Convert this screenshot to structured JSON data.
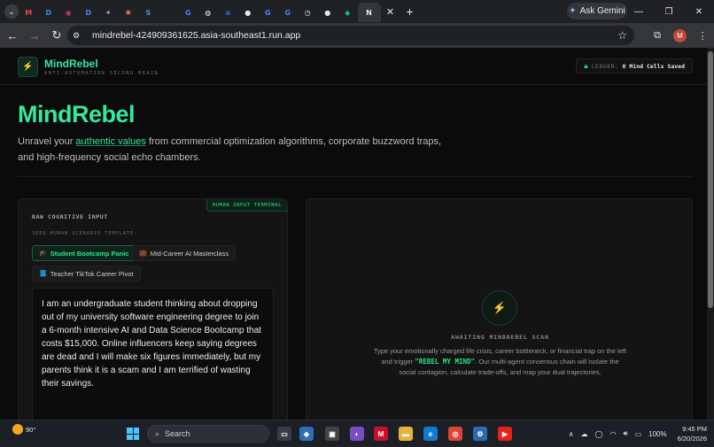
{
  "browser": {
    "tabs": [
      {
        "icon": "tab-menu-icon",
        "glyph": "⌄"
      },
      {
        "icon": "gmail-icon",
        "glyph": "M",
        "color": "#ea4335"
      },
      {
        "icon": "d-icon",
        "glyph": "D",
        "color": "#4285f4"
      },
      {
        "icon": "profile-icon",
        "glyph": "◉",
        "color": "#c13584"
      },
      {
        "icon": "d-icon",
        "glyph": "D",
        "color": "#4285f4"
      },
      {
        "icon": "gemini-icon",
        "glyph": "✦",
        "color": "#8ab4f8"
      },
      {
        "icon": "claude-icon",
        "glyph": "✺",
        "color": "#d97757"
      },
      {
        "icon": "s-icon",
        "glyph": "S",
        "color": "#2d9cdb"
      },
      {
        "icon": "blank-icon",
        "glyph": "",
        "color": "#3c3c3c"
      },
      {
        "icon": "google-icon",
        "glyph": "G",
        "color": "#4285f4"
      },
      {
        "icon": "bot-icon",
        "glyph": "◍",
        "color": "#e8eaed"
      },
      {
        "icon": "a-icon",
        "glyph": "a",
        "color": "#1a73e8"
      },
      {
        "icon": "github-icon",
        "glyph": "●",
        "color": "#e8eaed"
      },
      {
        "icon": "google-icon",
        "glyph": "G",
        "color": "#4285f4"
      },
      {
        "icon": "google-icon",
        "glyph": "G",
        "color": "#4285f4"
      },
      {
        "icon": "history-icon",
        "glyph": "◷",
        "color": "#e8eaed"
      },
      {
        "icon": "github-icon",
        "glyph": "●",
        "color": "#e8eaed"
      },
      {
        "icon": "diamond-icon",
        "glyph": "◆",
        "color": "#17b890"
      },
      {
        "icon": "notion-icon",
        "glyph": "N",
        "color": "#e8eaed"
      }
    ],
    "ask_gemini": "Ask Gemini",
    "url": "mindrebel-424909361625.asia-southeast1.run.app",
    "avatar_letter": "M"
  },
  "app": {
    "brand": "MindRebel",
    "tagline": "ANTI-AUTOMATION SECOND BRAIN",
    "ledger_label": "LEDGER:",
    "ledger_value": "0 Mind Cells Saved",
    "hero_title": "MindRebel",
    "hero_sub_pre": "Unravel your ",
    "hero_sub_highlight": "authentic values",
    "hero_sub_post": " from commercial optimization algorithms, corporate buzzword traps, and high-frequency social echo chambers.",
    "terminal_badge": "HUMAN INPUT TERMINAL",
    "raw_label": "RAW COGNITIVE INPUT",
    "seed_label": "SEED HUMAN SCENARIO TEMPLATE:",
    "templates": [
      {
        "label": "Student Bootcamp Panic",
        "icon": "🎓",
        "selected": true
      },
      {
        "label": "Mid-Career AI Masterclass",
        "icon": "💼",
        "selected": false
      },
      {
        "label": "Teacher TikTok Career Pivot",
        "icon": "📘",
        "selected": false
      }
    ],
    "input_text": "I am an undergraduate student thinking about dropping out of my university software engineering degree to join a 6-month intensive AI and Data Science Bootcamp that costs $15,000. Online influencers keep saying degrees are dead and I will make six figures immediately, but my parents think it is a scam and I am terrified of wasting their savings.",
    "await_title": "AWAITING MINDREBEL SCAN",
    "await_pre": "Type your emotionally charged life crisis, career bottleneck, or financial trap on the left and trigger ",
    "await_code": "\"REBEL MY MIND\"",
    "await_post": ". Our multi-agent consensus chain will isolate the social contagion, calculate trade-offs, and map your dual trajectories."
  },
  "taskbar": {
    "temperature": "90°",
    "search_placeholder": "Search",
    "battery": "100%",
    "time": "9:45 PM",
    "date": "6/20/2026"
  }
}
